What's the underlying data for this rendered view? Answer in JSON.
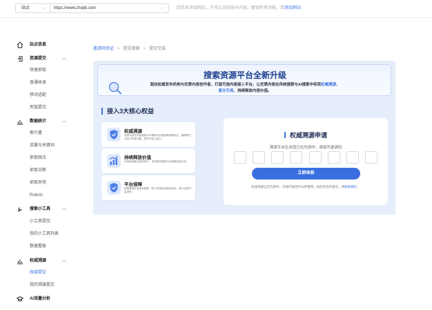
{
  "topbar": {
    "site_label": "站点",
    "url_value": "https://www.zhujib.com",
    "notice": "因您未添加网站，只可以浏览部分内容。解锁所有功能，请",
    "notice_link": "添加网站"
  },
  "sidebar": {
    "site_info": "站点信息",
    "resource_submit": "资源提交",
    "resource_items": [
      "快速抓取",
      "普通收录",
      "移动适配",
      "死链提交"
    ],
    "data_stats": "数据统计",
    "data_items": [
      "索引量",
      "流量与关键词",
      "抓取频次",
      "抓取诊断",
      "抓取异常",
      "Robots"
    ],
    "mini_tools": "搜索小工具",
    "tool_items": [
      "小工具提交",
      "我的小工具列表",
      "数据看板"
    ],
    "authority": "权威溯源",
    "authority_items": [
      "权威提交",
      "我的溯源提交"
    ],
    "ai_analysis": "AI流量分析"
  },
  "breadcrumb": {
    "first": "邀请码验证",
    "second": "提交搜索",
    "third": "提交完成"
  },
  "banner": {
    "title": "搜索资源平台全新升级",
    "desc_main": "面向权威发布机构与优质内容创作者，打造可信内容接入平台，让优质内容在传统搜索与AI搜索中实现",
    "desc_hl1": "权威溯源、",
    "desc_hl2": "原文引用",
    "desc_tail": "、持续释放内容价值。"
  },
  "benefits": {
    "section_title": "接入3大核心权益",
    "items": [
      {
        "title": "权威溯源",
        "desc": "优质内容在传统搜索与AI搜索中实现权威溯源标注，保障原文出处与作者归属，提升内容公信力。"
      },
      {
        "title": "持续释放价值",
        "desc": "内容持续触达更多用户，支持原文搜索与AI搜索持续引流。"
      },
      {
        "title": "平台保障",
        "desc": "权限受保护且稳定更新，助力内容机构高效发布，减少优质内容流失。"
      }
    ]
  },
  "apply": {
    "title": "权威溯源申请",
    "hint": "溯源平台生态现已在内测中，请填写邀请码",
    "button": "立即体验",
    "note": "权威溯源正在内测中，仅限内测合作伙伴使用，如您有合作意向，请",
    "note_link": "联系我们",
    "note_tail": "。",
    "code_count": 8
  },
  "colors": {
    "accent": "#3b6fe0",
    "card_bg": "#e6eefb"
  }
}
